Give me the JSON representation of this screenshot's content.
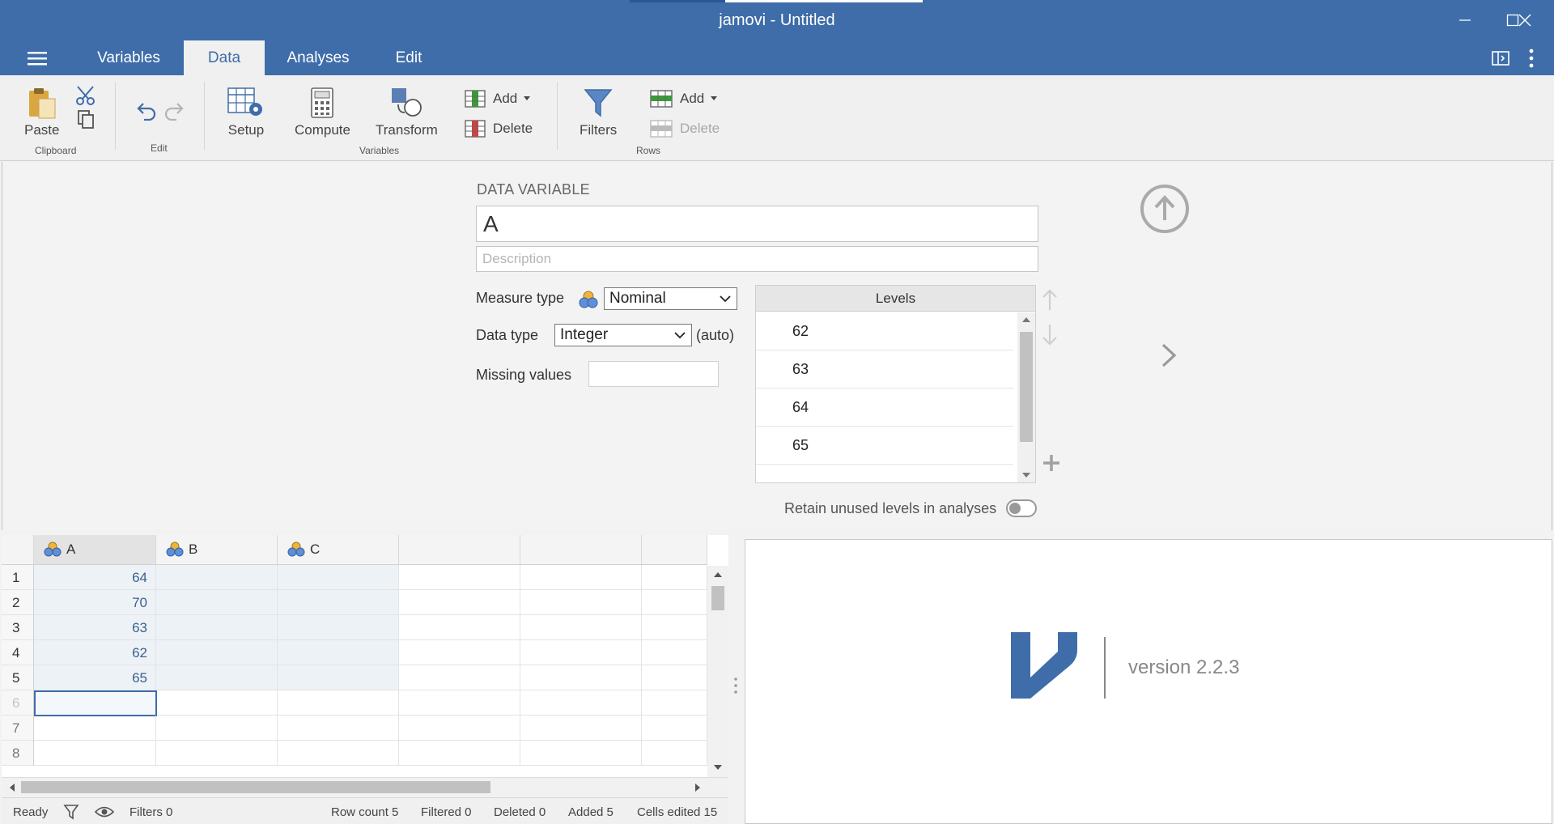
{
  "window": {
    "title": "jamovi - Untitled",
    "controls": [
      "minimize-icon",
      "maximize-icon",
      "close-icon"
    ]
  },
  "tabs": [
    {
      "label": "Variables",
      "active": false
    },
    {
      "label": "Data",
      "active": true
    },
    {
      "label": "Analyses",
      "active": false
    },
    {
      "label": "Edit",
      "active": false
    }
  ],
  "ribbon": {
    "clipboard": {
      "paste_label": "Paste",
      "group_label": "Clipboard"
    },
    "edit": {
      "group_label": "Edit"
    },
    "variables": {
      "setup_label": "Setup",
      "compute_label": "Compute",
      "transform_label": "Transform",
      "add_label": "Add",
      "delete_label": "Delete",
      "group_label": "Variables"
    },
    "filters_label": "Filters",
    "rows": {
      "add_label": "Add",
      "delete_label": "Delete",
      "group_label": "Rows"
    }
  },
  "setup": {
    "title": "DATA VARIABLE",
    "name_value": "A",
    "description_placeholder": "Description",
    "measure_type_label": "Measure type",
    "measure_type_value": "Nominal",
    "data_type_label": "Data type",
    "data_type_value": "Integer",
    "data_type_auto": "(auto)",
    "missing_values_label": "Missing values",
    "levels_header": "Levels",
    "levels": [
      "62",
      "63",
      "64",
      "65"
    ],
    "retain_label": "Retain unused levels in analyses",
    "retain_on": false
  },
  "sheet": {
    "columns": [
      "A",
      "B",
      "C"
    ],
    "row_numbers": [
      "1",
      "2",
      "3",
      "4",
      "5",
      "6",
      "7",
      "8"
    ],
    "values_A": [
      "64",
      "70",
      "63",
      "62",
      "65"
    ]
  },
  "status": {
    "ready": "Ready",
    "filters": "Filters 0",
    "row_count": "Row count 5",
    "filtered": "Filtered 0",
    "deleted": "Deleted 0",
    "added": "Added 5",
    "cells_edited": "Cells edited 15"
  },
  "results": {
    "version": "version 2.2.3"
  },
  "colors": {
    "brand": "#3e6da9",
    "cell_text": "#3c5f8e"
  }
}
